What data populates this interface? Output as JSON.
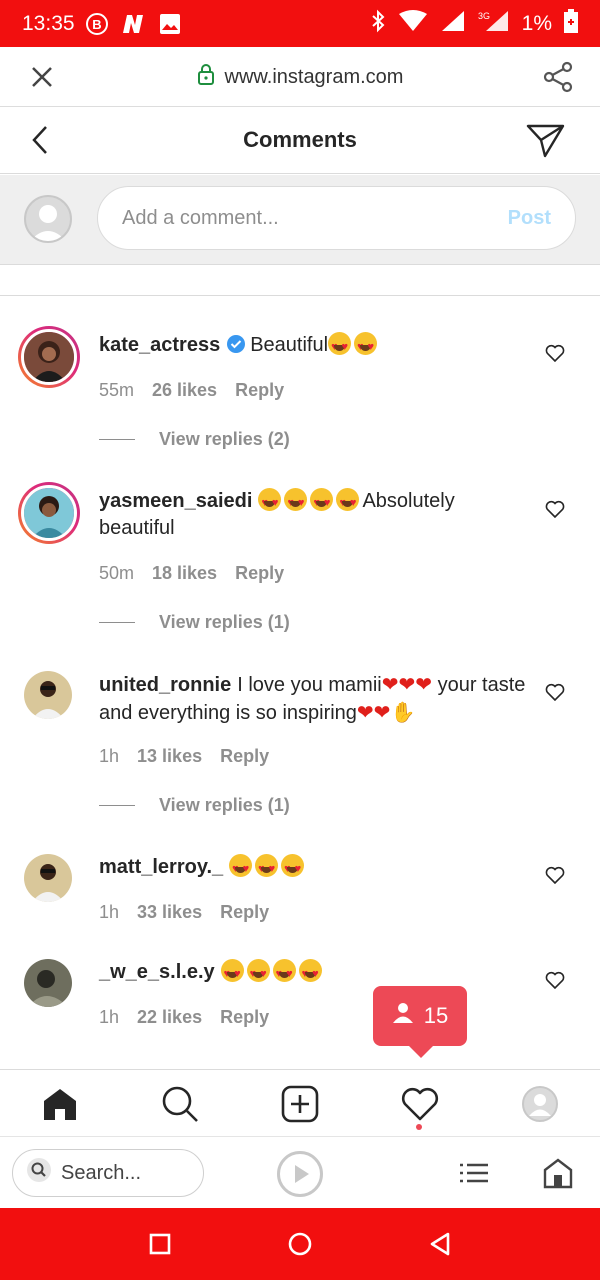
{
  "status_bar": {
    "time": "13:35",
    "battery": "1%",
    "network_label": "3G",
    "colors": {
      "background": "#f20f0f"
    }
  },
  "browser": {
    "url": "www.instagram.com",
    "search_placeholder": "Search..."
  },
  "header": {
    "title": "Comments"
  },
  "compose": {
    "placeholder": "Add a comment...",
    "post_label": "Post"
  },
  "comments": [
    {
      "username": "kate_actress",
      "verified": true,
      "text": "Beautiful",
      "emoji_after": "😍😍",
      "time": "55m",
      "likes": "26 likes",
      "reply": "Reply",
      "view_replies": "View replies (2)"
    },
    {
      "username": "yasmeen_saiedi",
      "verified": false,
      "emoji_before": "😍😍😍😍",
      "text": "Absolutely beautiful",
      "time": "50m",
      "likes": "18 likes",
      "reply": "Reply",
      "view_replies": "View replies (1)"
    },
    {
      "username": "united_ronnie",
      "verified": false,
      "text": "I love you mamii",
      "text2": " your taste and everything is so inspiring",
      "time": "1h",
      "likes": "13 likes",
      "reply": "Reply",
      "view_replies": "View replies (1)"
    },
    {
      "username": "matt_lerroy._",
      "verified": false,
      "emoji_after": "😍😍😍",
      "time": "1h",
      "likes": "33 likes",
      "reply": "Reply"
    },
    {
      "username": "_w_e_s.l.e.y",
      "verified": false,
      "emoji_after": "😍😍😍😍",
      "time": "1h",
      "likes": "22 likes",
      "reply": "Reply"
    }
  ],
  "notification": {
    "count": "15",
    "icon": "person-icon"
  },
  "app_nav": [
    "home-icon",
    "search-icon",
    "new-post-icon",
    "activity-heart-icon",
    "profile-icon"
  ],
  "accent_colors": {
    "notification": "#ed4956",
    "verified": "#3897f0",
    "post_disabled": "#b2dffc"
  }
}
